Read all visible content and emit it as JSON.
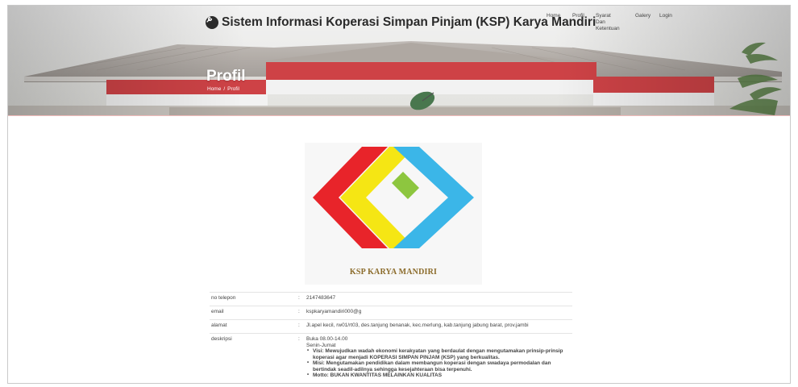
{
  "header": {
    "brand_title": "Sistem Informasi Koperasi Simpan Pinjam (KSP) Karya Mandiri",
    "brand_icon": "wrench-icon"
  },
  "nav": {
    "items": [
      {
        "label": "Home"
      },
      {
        "label": "Profil"
      },
      {
        "label": "Syarat\nDan\nKetentuan"
      },
      {
        "label": "Galery"
      },
      {
        "label": "Login"
      }
    ]
  },
  "hero": {
    "title": "Profil",
    "breadcrumb": {
      "home": "Home",
      "sep": "/",
      "current": "Profil"
    }
  },
  "logo": {
    "text": "KSP KARYA MANDIRI",
    "colors": {
      "red": "#e8242a",
      "yellow": "#f5e614",
      "blue": "#3bb6e8",
      "green": "#8dc63f"
    }
  },
  "profile": {
    "rows": [
      {
        "label": "no telepon",
        "sep": ":",
        "value": "2147483647"
      },
      {
        "label": "email",
        "sep": ":",
        "value": "kspkaryamandiri000@g"
      },
      {
        "label": "alamat",
        "sep": ":",
        "value": "Jl.apel kecil, rw01/rt03, des.tanjung benanak, kec.merlung, kab.tanjung jabung barat, prov.jambi"
      }
    ],
    "deskripsi": {
      "label": "deskripsi",
      "sep": ":",
      "line1": "Buka 08.00-14.00",
      "line2": "Senin-Jumat",
      "bullets": [
        "Visi: Mewujudkan wadah ekonomi kerakyatan yang berdaulat dengan mengutamakan prinsip-prinsip koperasi agar menjadi KOPERASI SIMPAN PINJAM (KSP) yang berkualitas.",
        "Misi:  Mengutamakan pendidikan dalam membangun koperasi dengan swadaya permodalan dan bertindak seadil-adilnya sehingga kesejahteraan bisa terpenuhi.",
        "Motto: BUKAN KWANTITAS MELAINKAN KUALITAS"
      ]
    }
  }
}
